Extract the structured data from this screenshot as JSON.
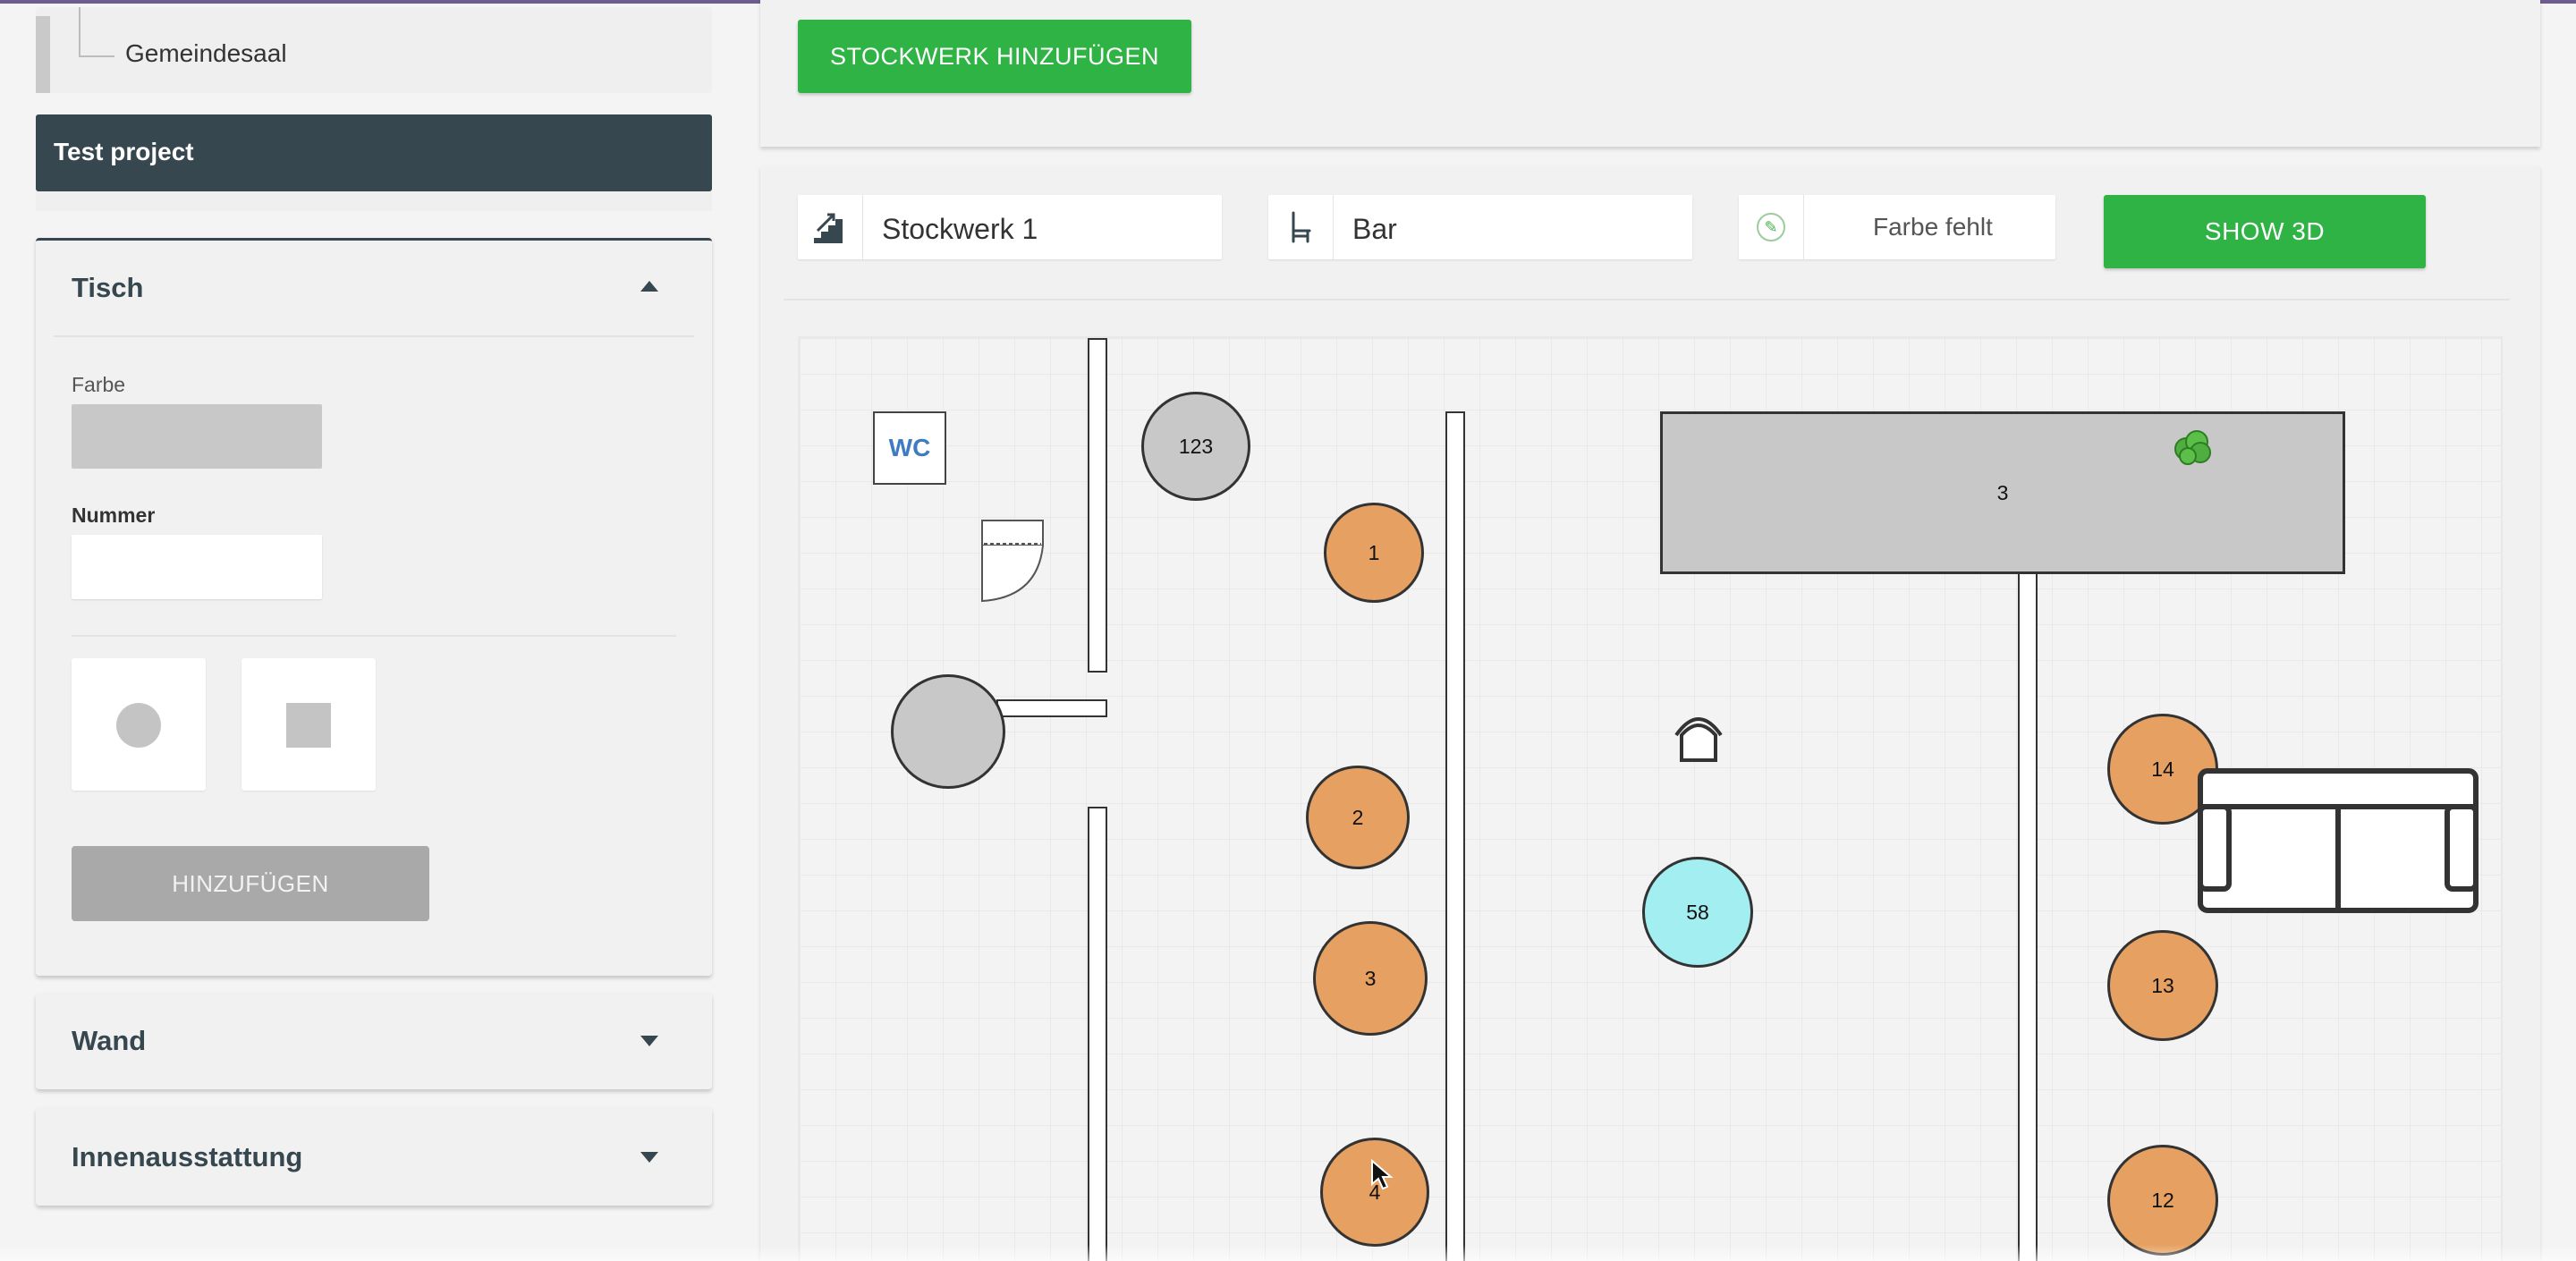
{
  "sidebar": {
    "tree_item": "Gemeindesaal",
    "project": "Test project",
    "sections": [
      {
        "title": "Tisch",
        "expanded": true
      },
      {
        "title": "Wand",
        "expanded": false
      },
      {
        "title": "Innenausstattung",
        "expanded": false
      }
    ],
    "tisch": {
      "color_label": "Farbe",
      "number_label": "Nummer",
      "number_value": "",
      "shape_options": [
        "circle-shape-icon",
        "square-shape-icon"
      ],
      "add_button": "HINZUFÜGEN"
    }
  },
  "toolbar": {
    "add_floor_button": "STOCKWERK HINZUFÜGEN",
    "floor_select": "Stockwerk 1",
    "type_select": "Bar",
    "color_select": "Farbe fehlt",
    "show3d_button": "SHOW 3D"
  },
  "floorplan": {
    "wc_label": "WC",
    "tables": [
      {
        "number": "123",
        "color": "grey"
      },
      {
        "number": "1",
        "color": "orange"
      },
      {
        "number": "2",
        "color": "orange"
      },
      {
        "number": "3",
        "color": "orange"
      },
      {
        "number": "4",
        "color": "orange"
      },
      {
        "number": "3",
        "color": "grey",
        "shape": "rect"
      },
      {
        "number": "58",
        "color": "cyan"
      },
      {
        "number": "14",
        "color": "orange"
      },
      {
        "number": "13",
        "color": "orange"
      },
      {
        "number": "12",
        "color": "orange"
      }
    ],
    "colors": {
      "orange": "#e6a061",
      "grey": "#c8c8c8",
      "cyan": "#a2eef0",
      "accent": "#2fb344",
      "dark": "#37474f"
    }
  }
}
